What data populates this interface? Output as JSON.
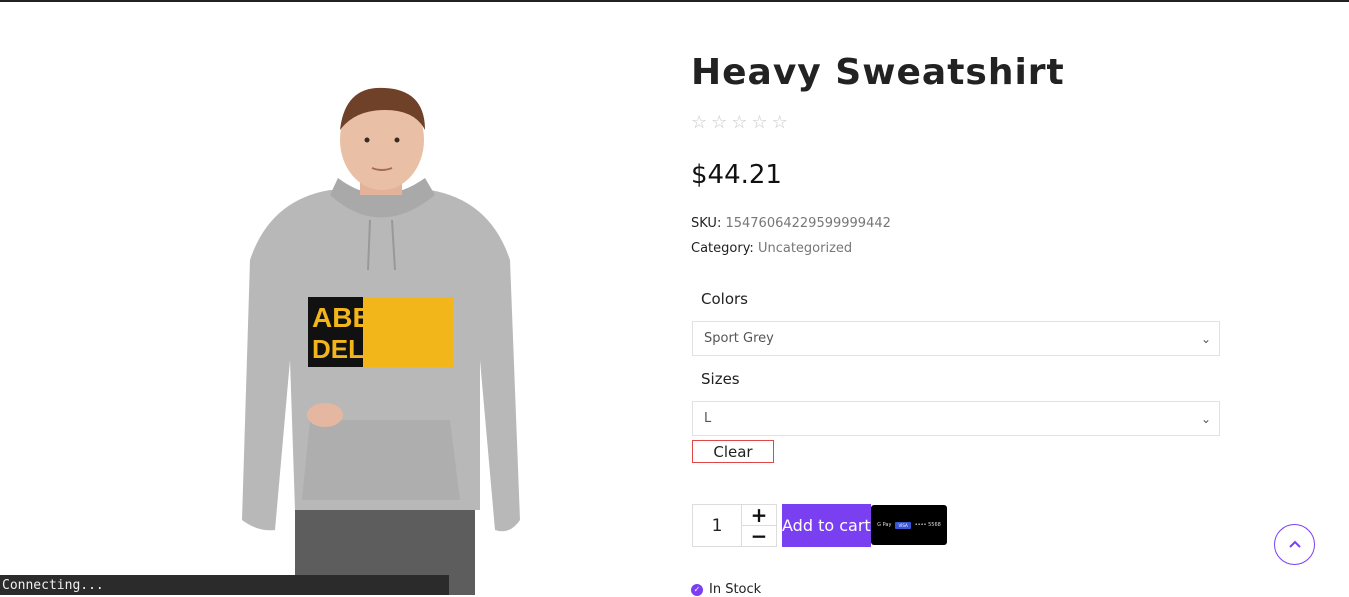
{
  "product": {
    "title": "Heavy Sweatshirt",
    "rating_stars": [
      "☆",
      "☆",
      "☆",
      "☆",
      "☆"
    ],
    "price": "$44.21",
    "sku_label": "SKU:",
    "sku_value": "15476064229599999442",
    "category_label": "Category:",
    "category_value": "Uncategorized",
    "print_text_line1": "ABBA'S",
    "print_text_line2": "DELIGHT"
  },
  "options": {
    "colors_label": "Colors",
    "colors_selected": "Sport Grey",
    "sizes_label": "Sizes",
    "sizes_selected": "L",
    "clear_label": "Clear"
  },
  "cart": {
    "quantity": "1",
    "plus": "+",
    "minus": "−",
    "add_to_cart_label": "Add to cart",
    "pay_button_text": "G Pay",
    "pay_card_brand": "VISA",
    "pay_card_digits": "•••• 5568"
  },
  "stock": {
    "status": "In Stock"
  },
  "statusbar": {
    "text": "Connecting..."
  },
  "colors": {
    "accent": "#7b3ff2",
    "clear_border": "#e04848",
    "hoodie": "#b5b5b5",
    "print_yellow": "#f2b61b"
  }
}
